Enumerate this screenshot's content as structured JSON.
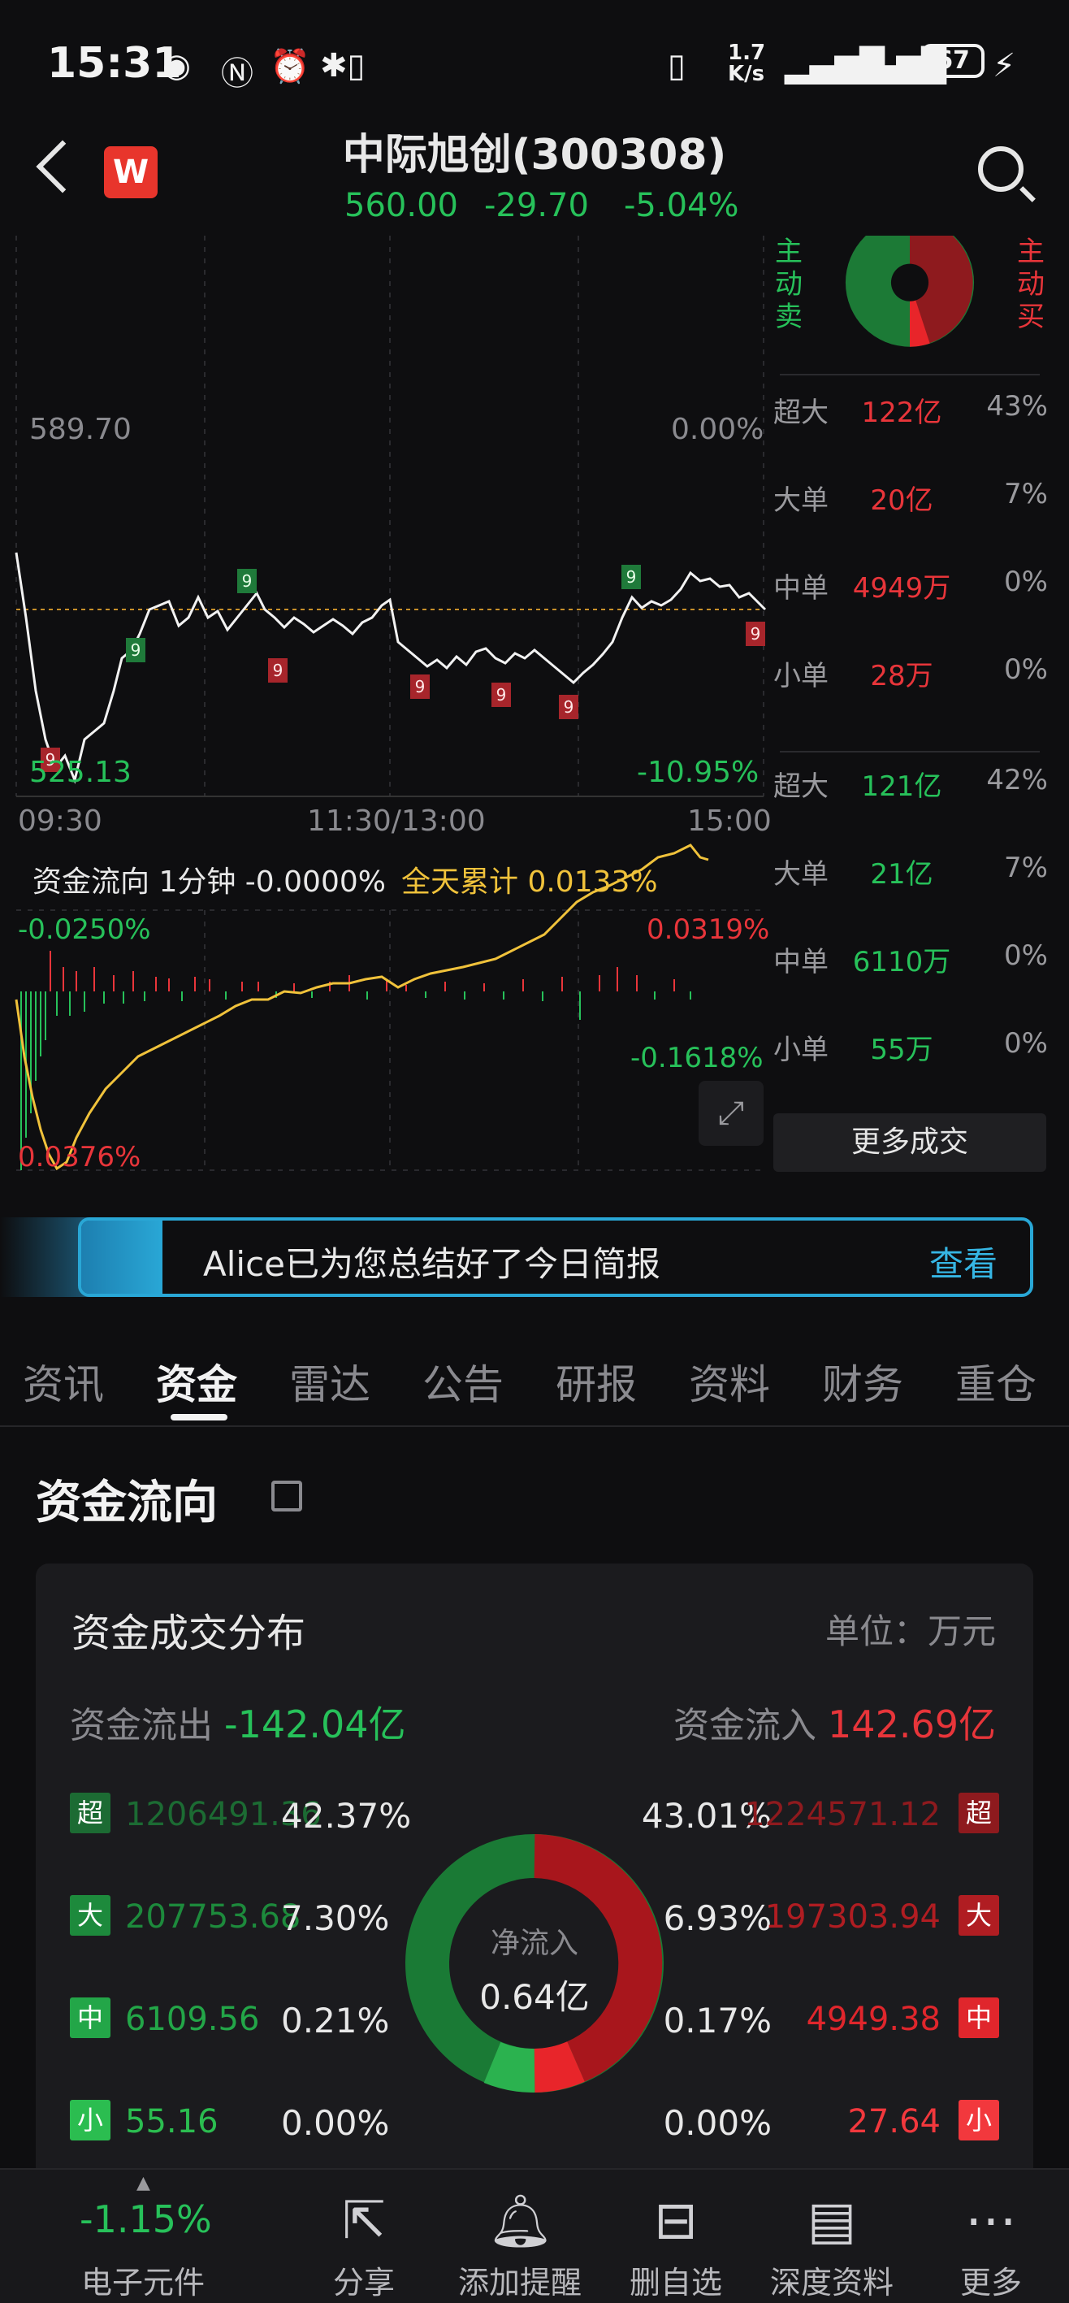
{
  "status_bar": {
    "time": "15:31",
    "net_speed": "1.7\nK/s",
    "battery": "67"
  },
  "header": {
    "logo_letter": "W",
    "title": "中际旭创(300308)",
    "price": "560.00",
    "change": "-29.70",
    "change_pct": "-5.04%"
  },
  "intraday_chart": {
    "y_high": "589.70",
    "y_high_pct": "0.00%",
    "y_low": "525.13",
    "y_low_pct": "-10.95%",
    "x_labels": [
      "09:30",
      "11:30/13:00",
      "15:00"
    ],
    "signal_marker": "9"
  },
  "flow_chart": {
    "label": "资金流向 1分钟 -0.0000%",
    "cumulative_label": "全天累计 0.0133%",
    "top_left": "-0.0250%",
    "top_right": "0.0319%",
    "mid_right": "-0.1618%",
    "bottom_left": "0.0376%"
  },
  "right_panel": {
    "sell_label": "主动卖",
    "buy_label": "主动买",
    "buy_rows": [
      {
        "label": "超大",
        "value": "122亿",
        "pct": "43%"
      },
      {
        "label": "大单",
        "value": "20亿",
        "pct": "7%"
      },
      {
        "label": "中单",
        "value": "4949万",
        "pct": "0%"
      },
      {
        "label": "小单",
        "value": "28万",
        "pct": "0%"
      }
    ],
    "sell_rows": [
      {
        "label": "超大",
        "value": "121亿",
        "pct": "42%"
      },
      {
        "label": "大单",
        "value": "21亿",
        "pct": "7%"
      },
      {
        "label": "中单",
        "value": "6110万",
        "pct": "0%"
      },
      {
        "label": "小单",
        "value": "55万",
        "pct": "0%"
      }
    ],
    "more_button": "更多成交"
  },
  "banner": {
    "text": "Alice已为您总结好了今日简报",
    "action": "查看"
  },
  "tabs": [
    "资讯",
    "资金",
    "雷达",
    "公告",
    "研报",
    "资料",
    "财务",
    "重仓"
  ],
  "section": {
    "title": "资金流向"
  },
  "distribution": {
    "title": "资金成交分布",
    "unit": "单位：万元",
    "outflow_label": "资金流出",
    "outflow_value": "-142.04亿",
    "inflow_label": "资金流入",
    "inflow_value": "142.69亿",
    "donut_label": "净流入",
    "donut_value": "0.64亿",
    "rows": [
      {
        "tag": "超",
        "out_value": "1206491.36",
        "out_pct": "42.37%",
        "in_pct": "43.01%",
        "in_value": "1224571.12"
      },
      {
        "tag": "大",
        "out_value": "207753.68",
        "out_pct": "7.30%",
        "in_pct": "6.93%",
        "in_value": "197303.94"
      },
      {
        "tag": "中",
        "out_value": "6109.56",
        "out_pct": "0.21%",
        "in_pct": "0.17%",
        "in_value": "4949.38"
      },
      {
        "tag": "小",
        "out_value": "55.16",
        "out_pct": "0.00%",
        "in_pct": "0.00%",
        "in_value": "27.64"
      }
    ]
  },
  "bottom_bar": {
    "sector_change": "-1.15%",
    "sector_name": "电子元件",
    "items": [
      "分享",
      "添加提醒",
      "删自选",
      "深度资料",
      "更多"
    ]
  },
  "colors": {
    "up": "#e8353a",
    "down": "#27c15a",
    "accent": "#36b6e4",
    "yellow": "#f0c23b"
  }
}
